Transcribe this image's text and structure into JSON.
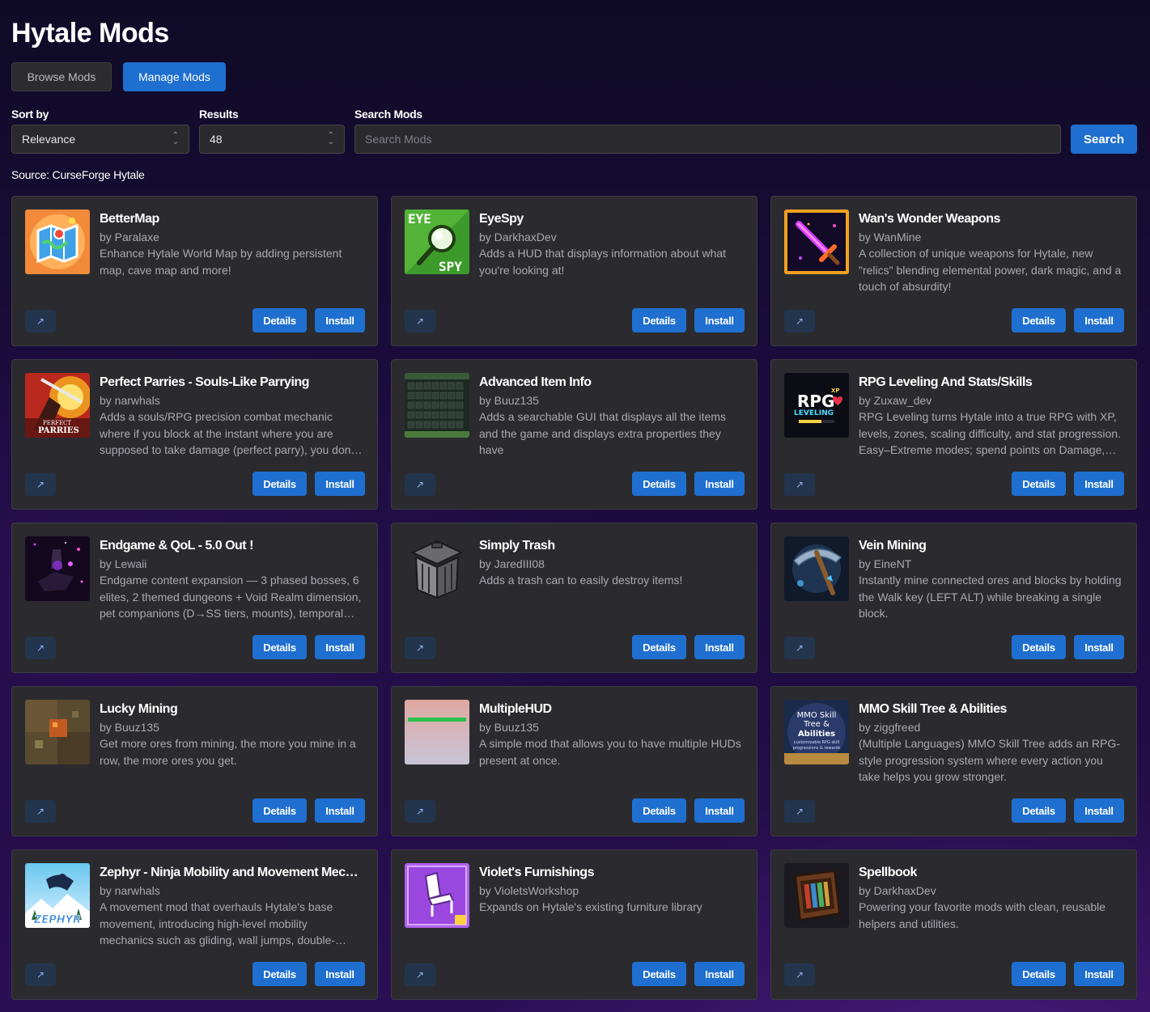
{
  "title": "Hytale Mods",
  "tabs": [
    {
      "label": "Browse Mods",
      "active": false
    },
    {
      "label": "Manage Mods",
      "active": true
    }
  ],
  "filters": {
    "sort_label": "Sort by",
    "sort_value": "Relevance",
    "results_label": "Results",
    "results_value": "48",
    "search_label": "Search Mods",
    "search_placeholder": "Search Mods",
    "search_button": "Search"
  },
  "source": "Source: CurseForge Hytale",
  "card_buttons": {
    "details": "Details",
    "install": "Install",
    "external": "↗"
  },
  "mods": [
    {
      "name": "BetterMap",
      "author": "by Paralaxe",
      "description": "Enhance Hytale World Map by adding persistent map, cave map and more!",
      "icon": "map-icon"
    },
    {
      "name": "EyeSpy",
      "author": "by DarkhaxDev",
      "description": "Adds a HUD that displays information about what you're looking at!",
      "icon": "eyespy-icon",
      "icon_text": [
        "EYE",
        "SPY"
      ]
    },
    {
      "name": "Wan's Wonder Weapons",
      "author": "by WanMine",
      "description": "A collection of unique weapons for Hytale, new \"relics\" blending elemental power, dark magic, and a touch of absurdity!",
      "icon": "sword-icon"
    },
    {
      "name": "Perfect Parries - Souls-Like Parrying",
      "author": "by narwhals",
      "description": "Adds a souls/RPG precision combat mechanic where if you block at the instant where you are supposed to take damage (perfect parry), you don't take damage.",
      "icon": "parry-icon",
      "icon_text": [
        "PERFECT",
        "PARRIES"
      ]
    },
    {
      "name": "Advanced Item Info",
      "author": "by Buuz135",
      "description": "Adds a searchable GUI that displays all the items and the game and displays extra properties they have",
      "icon": "item-grid-icon"
    },
    {
      "name": "RPG Leveling And Stats/Skills",
      "author": "by Zuxaw_dev",
      "description": "RPG Leveling turns Hytale into a true RPG with XP, levels, zones, scaling difficulty, and stat progression. Easy–Extreme modes; spend points on Damage, Health and more.",
      "icon": "rpg-icon",
      "icon_text": [
        "RPG",
        "LEVELING",
        "XP"
      ]
    },
    {
      "name": "Endgame & QoL - 5.0 Out !",
      "author": "by Lewaii",
      "description": "Endgame content expansion — 3 phased bosses, 6 elites, 2 themed dungeons + Void Realm dimension, pet companions (D→SS tiers, mounts), temporal rifts and more.",
      "icon": "void-realm-icon"
    },
    {
      "name": "Simply Trash",
      "author": "by JaredIII08",
      "description": "Adds a trash can to easily destroy items!",
      "icon": "trash-can-icon"
    },
    {
      "name": "Vein Mining",
      "author": "by EineNT",
      "description": "Instantly mine connected ores and blocks by holding the Walk key (LEFT ALT) while breaking a single block.",
      "icon": "pickaxe-icon"
    },
    {
      "name": "Lucky Mining",
      "author": "by Buuz135",
      "description": "Get more ores from mining, the more you mine in a row, the more ores you get.",
      "icon": "cave-ore-icon"
    },
    {
      "name": "MultipleHUD",
      "author": "by Buuz135",
      "description": "A simple mod that allows you to have multiple HUDs present at once.",
      "icon": "hud-preview-icon"
    },
    {
      "name": "MMO Skill Tree & Abilities",
      "author": "by ziggfreed",
      "description": "(Multiple Languages) MMO Skill Tree adds an RPG-style progression system where every action you take helps you grow stronger.",
      "icon": "skill-tree-icon",
      "icon_text": [
        "MMO Skill",
        "Tree &",
        "Abilities",
        "customizable RPG skill",
        "progressions & rewards"
      ]
    },
    {
      "name": "Zephyr - Ninja Mobility and Movement Mechanics",
      "author": "by narwhals",
      "description": "A movement mod that overhauls Hytale's base movement, introducing high-level mobility mechanics such as gliding, wall jumps, double-jumps and more.",
      "icon": "zephyr-icon",
      "icon_text": [
        "ZEPHYR"
      ]
    },
    {
      "name": "Violet's Furnishings",
      "author": "by VioletsWorkshop",
      "description": "Expands on Hytale's existing furniture library",
      "icon": "chair-icon"
    },
    {
      "name": "Spellbook",
      "author": "by DarkhaxDev",
      "description": "Powering your favorite mods with clean, reusable helpers and utilities.",
      "icon": "bookshelf-icon"
    }
  ],
  "colors": {
    "accent": "#1f6fd0",
    "card": "#2b2b2f",
    "background": "#1a0c3c"
  }
}
